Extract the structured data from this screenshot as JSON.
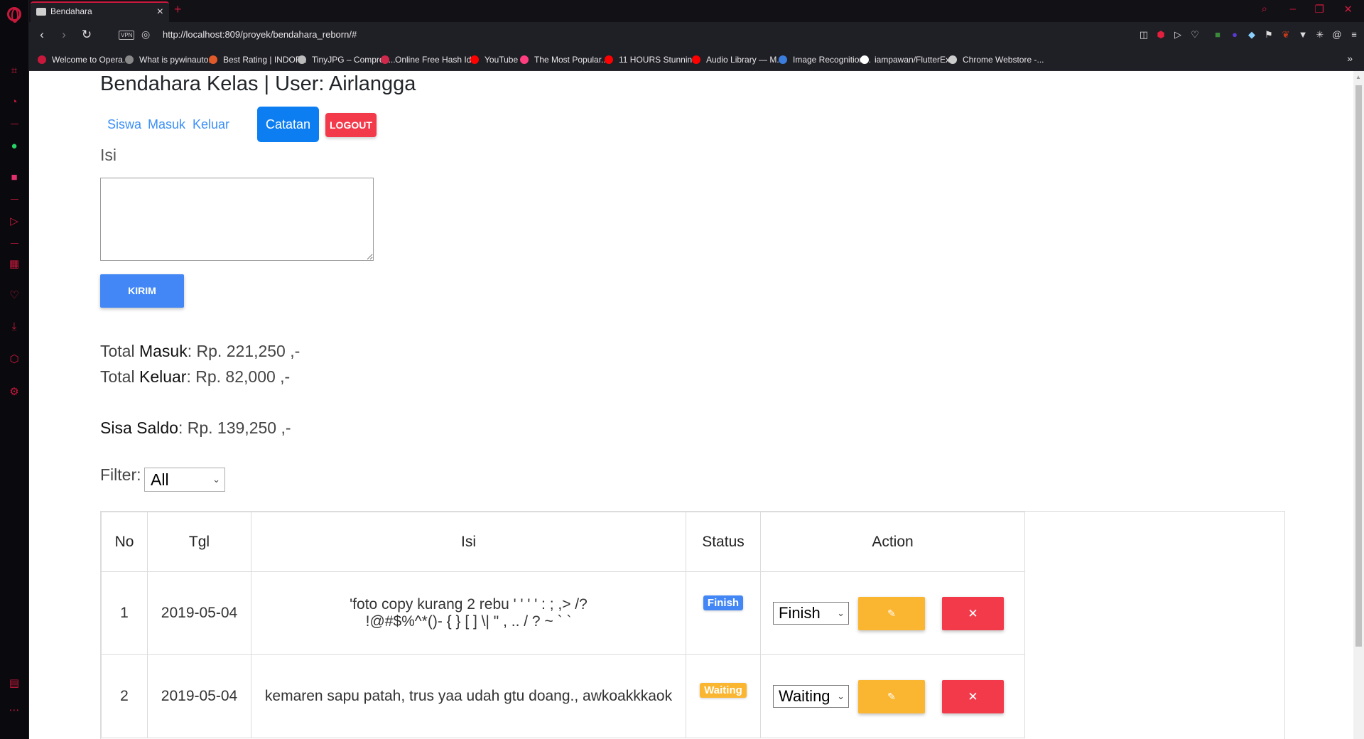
{
  "browser": {
    "tab_title": "Bendahara",
    "url": "http://localhost:809/proyek/bendahara_reborn/#",
    "vpn_label": "VPN",
    "accent": "#c8193c",
    "bookmarks": [
      {
        "label": "Welcome to Opera...",
        "color": "#c8193c"
      },
      {
        "label": "What is pywinauto...",
        "color": "#888888"
      },
      {
        "label": "Best Rating | INDOF...",
        "color": "#e05a2a"
      },
      {
        "label": "TinyJPG – Compres...",
        "color": "#bbbbbb"
      },
      {
        "label": "Online Free Hash Id...",
        "color": "#d0284a"
      },
      {
        "label": "YouTube",
        "color": "#ff0000"
      },
      {
        "label": "The Most Popular...",
        "color": "#ff3d7f"
      },
      {
        "label": "11 HOURS Stunnin...",
        "color": "#ff0000"
      },
      {
        "label": "Audio Library — M...",
        "color": "#ff0000"
      },
      {
        "label": "Image Recognition...",
        "color": "#3b7ddd"
      },
      {
        "label": "iampawan/FlutterEx...",
        "color": "#ffffff"
      },
      {
        "label": "Chrome Webstore -...",
        "color": "#cccccc"
      }
    ]
  },
  "app": {
    "title": "Bendahara Kelas | User: Airlangga",
    "nav": [
      {
        "label": "Siswa",
        "active": false
      },
      {
        "label": "Masuk",
        "active": false
      },
      {
        "label": "Keluar",
        "active": false
      },
      {
        "label": "Catatan",
        "active": true
      }
    ],
    "logout_label": "LOGOUT",
    "isi_label": "Isi",
    "isi_value": "",
    "kirim_label": "KIRIM",
    "totals": {
      "masuk_prefix": "Total ",
      "masuk_key": "Masuk",
      "masuk_value": ": Rp. 221,250 ,-",
      "keluar_prefix": "Total ",
      "keluar_key": "Keluar",
      "keluar_value": ": Rp. 82,000 ,-",
      "saldo_key": "Sisa Saldo",
      "saldo_value": ": Rp. 139,250 ,-"
    },
    "filter": {
      "label": "Filter:",
      "selected": "All"
    },
    "table": {
      "headers": [
        "No",
        "Tgl",
        "Isi",
        "Status",
        "Action"
      ],
      "rows": [
        {
          "no": "1",
          "tgl": "2019-05-04",
          "isi_line1": "'foto copy kurang 2 rebu ' ' ' ' : ; ,> /?",
          "isi_line2": "!@#$%^*()- { } [ ] \\| \" , .. / ? ~ ` `",
          "status": "Finish",
          "action_value": "Finish"
        },
        {
          "no": "2",
          "tgl": "2019-05-04",
          "isi_line1": "kemaren sapu patah, trus yaa udah gtu doang., awkoakkkaok",
          "isi_line2": "",
          "status": "Waiting",
          "action_value": "Waiting"
        }
      ]
    },
    "colors": {
      "primary": "#0d7ef2",
      "danger": "#f33a4b",
      "warning": "#fbb631",
      "info": "#4287f5"
    }
  }
}
